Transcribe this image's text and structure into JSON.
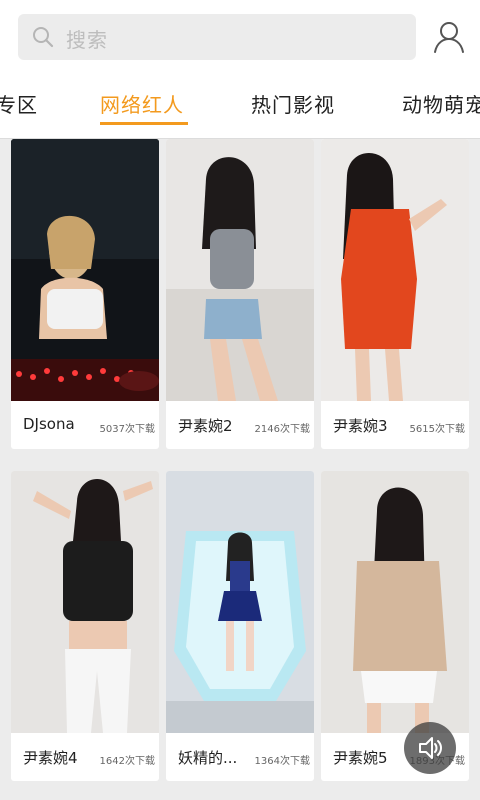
{
  "search": {
    "placeholder": "搜索"
  },
  "tabs": [
    {
      "label": "专区"
    },
    {
      "label": "网络红人"
    },
    {
      "label": "热门影视"
    },
    {
      "label": "动物萌宠"
    }
  ],
  "active_tab_index": 1,
  "colors": {
    "accent": "#f39a1e",
    "background": "#ececec"
  },
  "items": [
    {
      "name": "DJsona",
      "downloads": "5037次下载"
    },
    {
      "name": "尹素婉2",
      "downloads": "2146次下载"
    },
    {
      "name": "尹素婉3",
      "downloads": "5615次下载"
    },
    {
      "name": "尹素婉4",
      "downloads": "1642次下载"
    },
    {
      "name": "妖精的...",
      "downloads": "1364次下载"
    },
    {
      "name": "尹素婉5",
      "downloads": "1893次下载"
    }
  ],
  "icons": {
    "search": "search-icon",
    "user": "user-icon",
    "sound": "speaker-icon"
  }
}
